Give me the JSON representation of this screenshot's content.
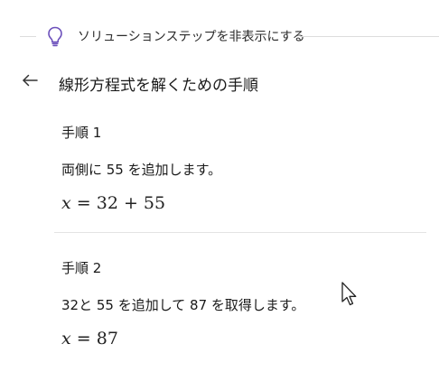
{
  "toggle": {
    "label": "ソリューションステップを非表示にする",
    "icon": "lightbulb-icon",
    "icon_color": "#6b4fbb"
  },
  "header": {
    "back_icon": "arrow-left-icon",
    "title": "線形方程式を解くための手順"
  },
  "steps": [
    {
      "title": "手順 1",
      "description": "両側に 55 を追加します。",
      "equation": {
        "lhs": "x",
        "eq": "=",
        "rhs": "32 + 55"
      }
    },
    {
      "title": "手順 2",
      "description": "32と 55 を追加して 87 を取得します。",
      "equation": {
        "lhs": "x",
        "eq": "=",
        "rhs": "87"
      }
    }
  ]
}
